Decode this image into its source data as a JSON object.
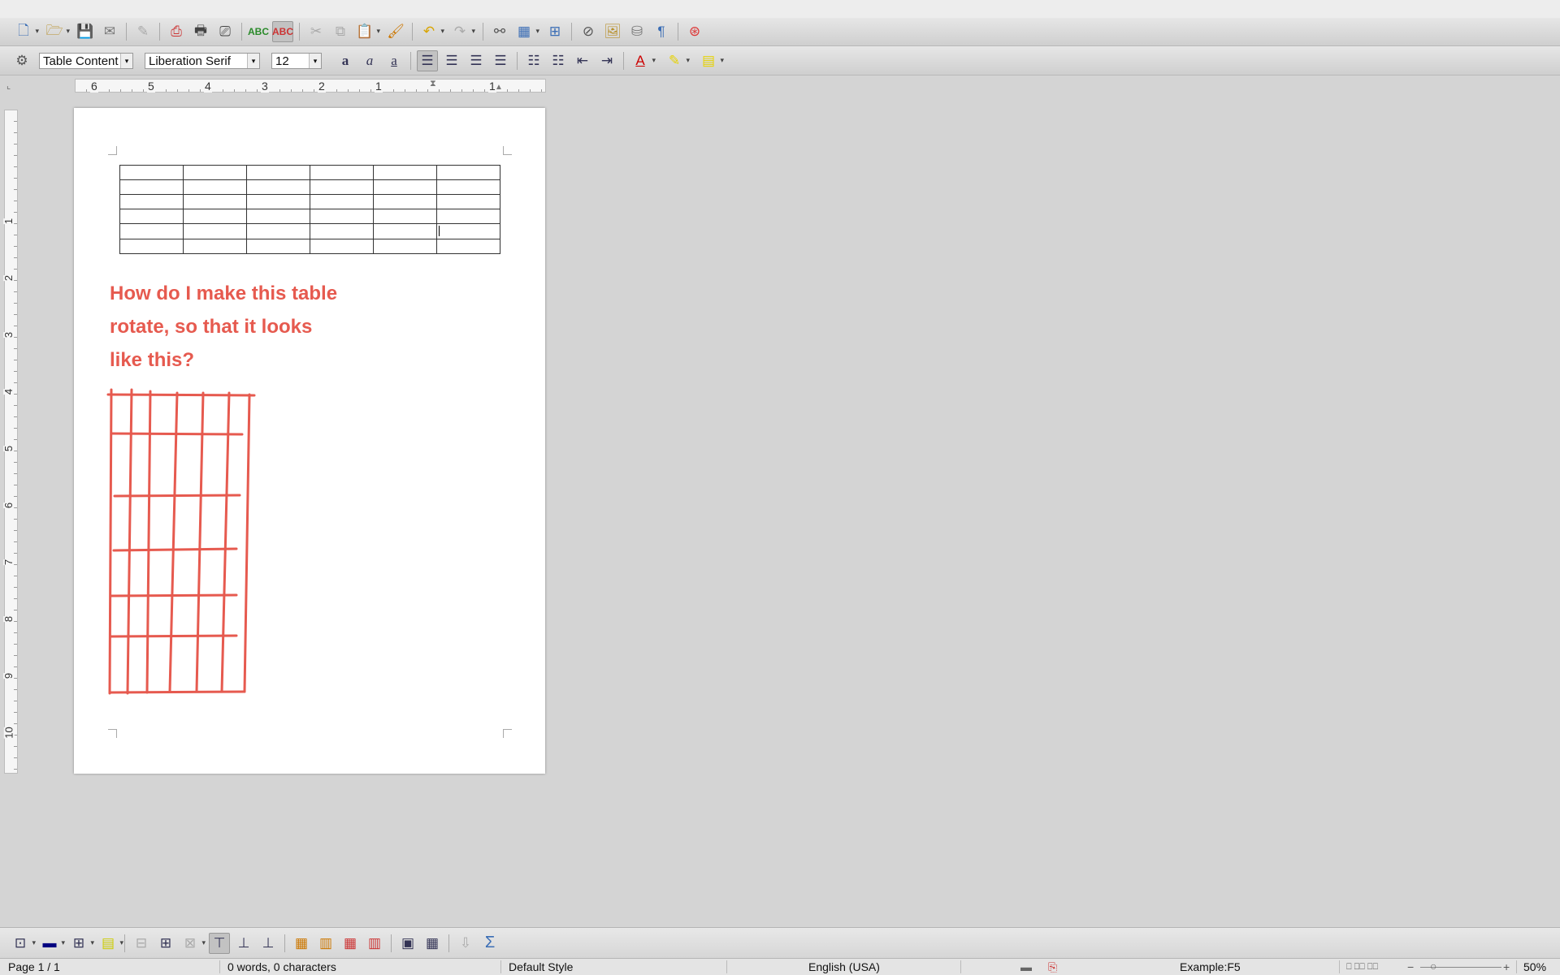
{
  "app": {
    "name": "LibreOffice Writer"
  },
  "toolbar_standard": {
    "icons": [
      "new-document-icon",
      "open-icon",
      "save-icon",
      "email-icon",
      "edit-mode-icon",
      "export-pdf-icon",
      "print-icon",
      "print-preview-icon",
      "spellcheck-icon",
      "autospellcheck-icon",
      "cut-icon",
      "copy-icon",
      "paste-icon",
      "clone-format-icon",
      "undo-icon",
      "redo-icon",
      "hyperlink-icon",
      "table-icon",
      "show-draw-functions-icon",
      "navigator-icon",
      "gallery-icon",
      "data-sources-icon",
      "formatting-marks-icon",
      "help-icon"
    ]
  },
  "toolbar_formatting": {
    "paragraph_style": "Table Content",
    "font_name": "Liberation Serif",
    "font_size": "12"
  },
  "ruler": {
    "horizontal_numbers": [
      "6",
      "5",
      "4",
      "3",
      "2",
      "1",
      "1"
    ],
    "vertical_numbers": [
      "1",
      "2",
      "3",
      "4",
      "5",
      "6",
      "7",
      "8",
      "9",
      "10"
    ]
  },
  "document": {
    "table": {
      "rows": 6,
      "cols": 6
    },
    "question_lines": [
      "How do I make this table",
      "rotate, so that it looks",
      "like this?"
    ],
    "annotation_color": "#e65a4f"
  },
  "status_bar": {
    "page": "Page 1 / 1",
    "words": "0 words, 0 characters",
    "page_style": "Default Style",
    "language": "English (USA)",
    "cell": "Example:F5",
    "zoom": "50%"
  }
}
